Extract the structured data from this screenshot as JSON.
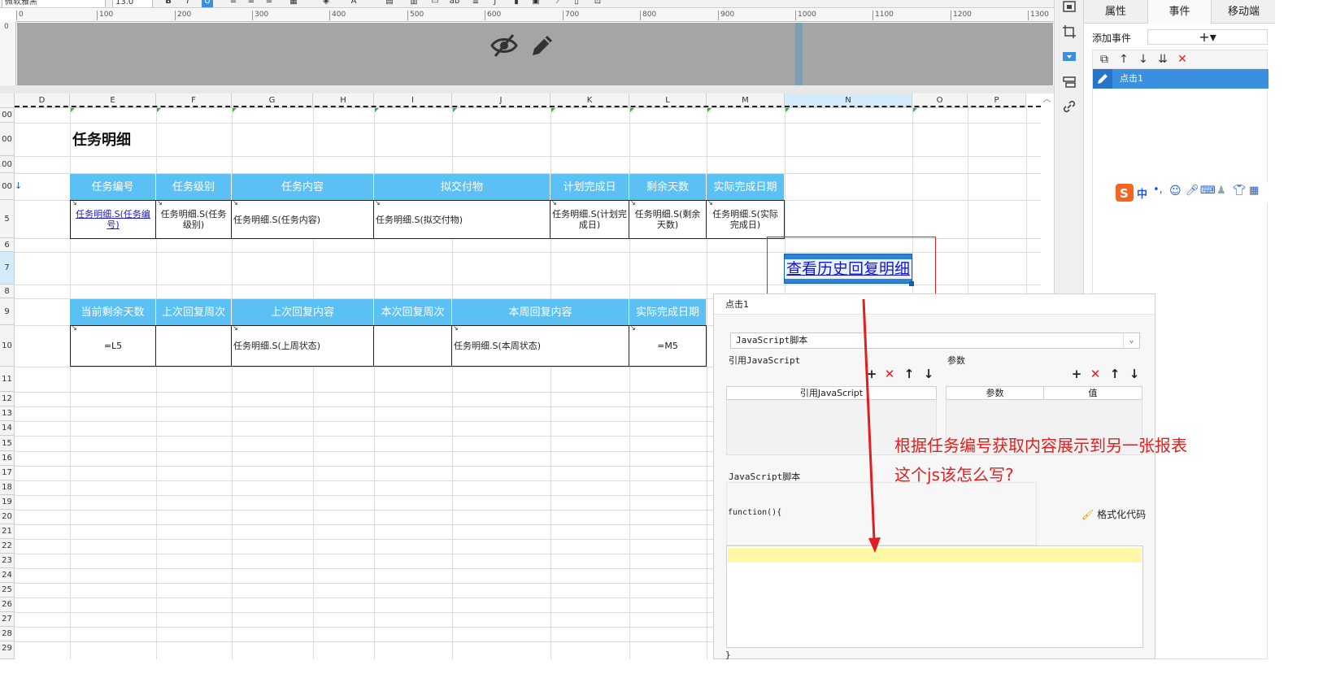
{
  "toolbar": {
    "font_name": "微软雅黑",
    "font_size": "13.0"
  },
  "ruler": {
    "ticks": [
      "0",
      "100",
      "200",
      "300",
      "400",
      "500",
      "600",
      "700",
      "800",
      "900",
      "1000",
      "1100",
      "1200",
      "1300"
    ],
    "vtick": "0"
  },
  "columns": [
    "D",
    "E",
    "F",
    "G",
    "H",
    "I",
    "J",
    "K",
    "L",
    "M",
    "N",
    "O",
    "P"
  ],
  "rows": [
    "00",
    "00",
    "00",
    "00",
    "5",
    "6",
    "7",
    "8",
    "9",
    "10",
    "11",
    "12",
    "13",
    "14",
    "15",
    "16",
    "17",
    "18",
    "19",
    "20",
    "21",
    "22",
    "23",
    "24",
    "25",
    "26",
    "27",
    "28",
    "29"
  ],
  "sheet": {
    "title": "任务明细",
    "header1": [
      "任务编号",
      "任务级别",
      "任务内容",
      "拟交付物",
      "计划完成日",
      "剩余天数",
      "实际完成日期"
    ],
    "data1": [
      "任务明细.S(任务编号)",
      "任务明细.S(任务级别)",
      "任务明细.S(任务内容)",
      "任务明细.S(拟交付物)",
      "任务明细.S(计划完成日)",
      "任务明细.S(剩余天数)",
      "任务明细.S(实际完成日)"
    ],
    "header2": [
      "当前剩余天数",
      "上次回复周次",
      "上次回复内容",
      "本次回复周次",
      "本周回复内容",
      "实际完成日期"
    ],
    "data2": [
      "=L5",
      "",
      "任务明细.S(上周状态)",
      "",
      "任务明细.S(本周状态)",
      "=M5"
    ],
    "button_text": "查看历史回复明细"
  },
  "right_panel": {
    "tabs": [
      "属性",
      "事件",
      "移动端"
    ],
    "active_tab": "事件",
    "add_event_label": "添加事件",
    "add_event_symbol": "+▾",
    "events": [
      "点击1"
    ]
  },
  "dialog": {
    "title": "点击1",
    "script_type": "JavaScript脚本",
    "ref_js_label": "引用JavaScript",
    "params_label": "参数",
    "ref_js_col": "引用JavaScript",
    "param_col": "参数",
    "value_col": "值",
    "script_label": "JavaScript脚本",
    "fn_header": "function(){",
    "format_label": "格式化代码",
    "close_brace": "}"
  },
  "annotation": {
    "line1": "根据任务编号获取内容展示到另一张报表",
    "line2": "这个js该怎么写?"
  },
  "colors": {
    "header_blue": "#5bc1f4",
    "accent": "#3b8fe0",
    "annotation_red": "#e02020"
  }
}
